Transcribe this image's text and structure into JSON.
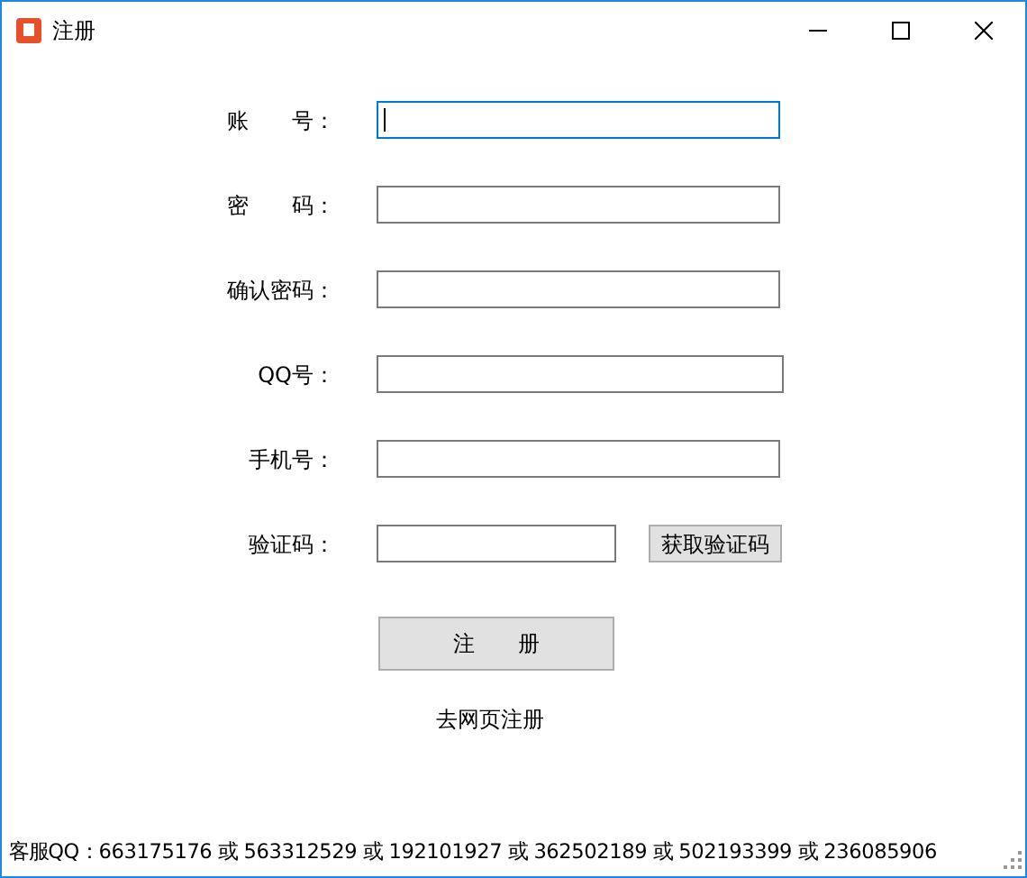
{
  "window": {
    "title": "注册"
  },
  "fields": [
    {
      "label": "账　　号：",
      "focused": true
    },
    {
      "label": "密　　码：",
      "focused": false
    },
    {
      "label": "确认密码：",
      "focused": false
    },
    {
      "label": "QQ号：",
      "focused": false
    },
    {
      "label": "手机号：",
      "focused": false
    },
    {
      "label": "验证码：",
      "focused": false,
      "button": "获取验证码"
    }
  ],
  "register_button": "注　　册",
  "web_link": "去网页注册",
  "status_bar": "客服QQ：663175176 或 563312529 或 192101927 或 362502189 或 502193399 或 236085906"
}
